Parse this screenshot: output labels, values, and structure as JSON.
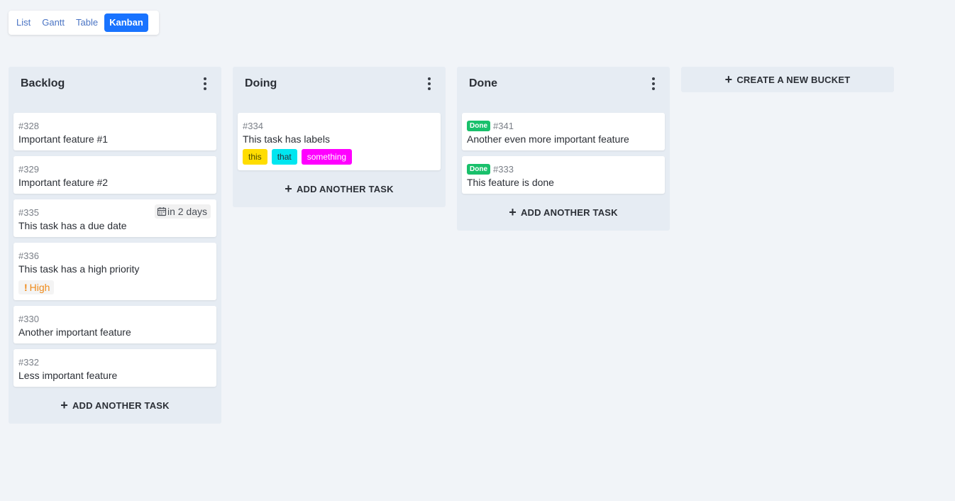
{
  "views": {
    "list": "List",
    "gantt": "Gantt",
    "table": "Table",
    "kanban": "Kanban",
    "active": "Kanban"
  },
  "buckets": [
    {
      "title": "Backlog",
      "tasks": [
        {
          "id": "#328",
          "title": "Important feature #1"
        },
        {
          "id": "#329",
          "title": "Important feature #2"
        },
        {
          "id": "#335",
          "title": "This task has a due date",
          "due": "in 2 days"
        },
        {
          "id": "#336",
          "title": "This task has a high priority",
          "priority": "High"
        },
        {
          "id": "#330",
          "title": "Another important feature"
        },
        {
          "id": "#332",
          "title": "Less important feature"
        }
      ],
      "add_label": "ADD ANOTHER TASK"
    },
    {
      "title": "Doing",
      "tasks": [
        {
          "id": "#334",
          "title": "This task has labels",
          "labels": [
            {
              "text": "this",
              "color": "#ffdd00",
              "text_color": "#4a4a00"
            },
            {
              "text": "that",
              "color": "#00e6f0",
              "text_color": "#2b2f36"
            },
            {
              "text": "something",
              "color": "#ff00ff",
              "text_color": "#ffffff"
            }
          ]
        }
      ],
      "add_label": "ADD ANOTHER TASK"
    },
    {
      "title": "Done",
      "tasks": [
        {
          "id": "#341",
          "title": "Another even more important feature",
          "badge": "Done"
        },
        {
          "id": "#333",
          "title": "This feature is done",
          "badge": "Done"
        }
      ],
      "add_label": "ADD ANOTHER TASK"
    }
  ],
  "new_bucket_label": "CREATE A NEW BUCKET",
  "colors": {
    "accent": "#1973ff",
    "done": "#19c06b",
    "priority_high": "#ef8a19"
  }
}
